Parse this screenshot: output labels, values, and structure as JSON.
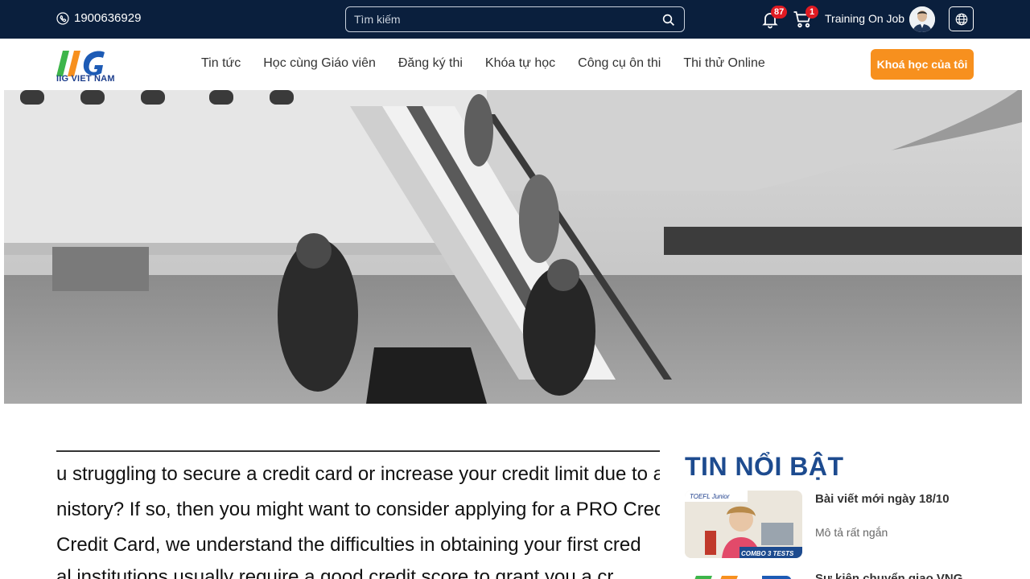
{
  "topbar": {
    "phone": "1900636929",
    "search_placeholder": "Tìm kiếm",
    "notifications_count": "87",
    "cart_count": "1",
    "user_name": "Training On Job"
  },
  "navbar": {
    "logo_text": "IIG VIET NAM",
    "items": [
      {
        "label": "Tin tức"
      },
      {
        "label": "Học cùng Giáo viên"
      },
      {
        "label": "Đăng ký thi"
      },
      {
        "label": "Khóa tự học"
      },
      {
        "label": "Công cụ ôn thi"
      },
      {
        "label": "Thi thử Online"
      }
    ],
    "my_courses": "Khoá học của tôi"
  },
  "hero": {
    "slide_count": 5,
    "active_slide": 1
  },
  "article": {
    "lines": [
      "u struggling to secure a credit card or increase your credit limit due to a",
      "nistory? If so, then you might want to consider applying for a PRO Cred",
      "Credit Card, we understand the difficulties in obtaining your first cred",
      "al institutions usually require a good credit score to grant you a cr"
    ]
  },
  "sidebar": {
    "title": "TIN NỔI BẬT",
    "news": [
      {
        "title": "Bài viết mới ngày 18/10",
        "description": "Mô tả rất ngắn",
        "thumb_tag": "TOEFL Junior",
        "thumb_banner": "COMBO 3 TESTS"
      },
      {
        "title": "Sự kiện chuyển giao VNG"
      }
    ]
  },
  "colors": {
    "topbar_bg": "#0a1f3d",
    "accent_orange": "#f7901e",
    "title_blue": "#1d4b8f",
    "badge_red": "#e01a22"
  }
}
